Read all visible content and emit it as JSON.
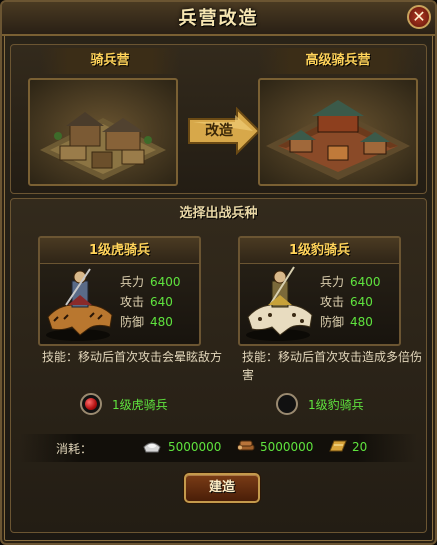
{
  "window": {
    "title": "兵营改造",
    "close_symbol": "✕"
  },
  "upgrade": {
    "from_label": "骑兵营",
    "to_label": "高级骑兵营",
    "arrow_label": "改造"
  },
  "unit_select": {
    "section_title": "选择出战兵种",
    "units": [
      {
        "name": "1级虎骑兵",
        "stats": [
          {
            "label": "兵力",
            "value": "6400"
          },
          {
            "label": "攻击",
            "value": "640"
          },
          {
            "label": "防御",
            "value": "480"
          }
        ],
        "skill": "技能：移动后首次攻击会晕眩敌方",
        "radio_label": "1级虎骑兵",
        "selected": true
      },
      {
        "name": "1级豹骑兵",
        "stats": [
          {
            "label": "兵力",
            "value": "6400"
          },
          {
            "label": "攻击",
            "value": "640"
          },
          {
            "label": "防御",
            "value": "480"
          }
        ],
        "skill": "技能：移动后首次攻击造成多倍伤害",
        "radio_label": "1级豹骑兵",
        "selected": false
      }
    ]
  },
  "cost": {
    "label": "消耗：",
    "silver": "5000000",
    "wood": "5000000",
    "token": "20",
    "icons": [
      "silver-ingot-icon",
      "wood-logs-icon",
      "gold-token-icon"
    ]
  },
  "build_button": "建造",
  "colors": {
    "accent_gold": "#ffd35a",
    "stat_green": "#5fe33e",
    "frame_bronze": "#6b5532"
  }
}
